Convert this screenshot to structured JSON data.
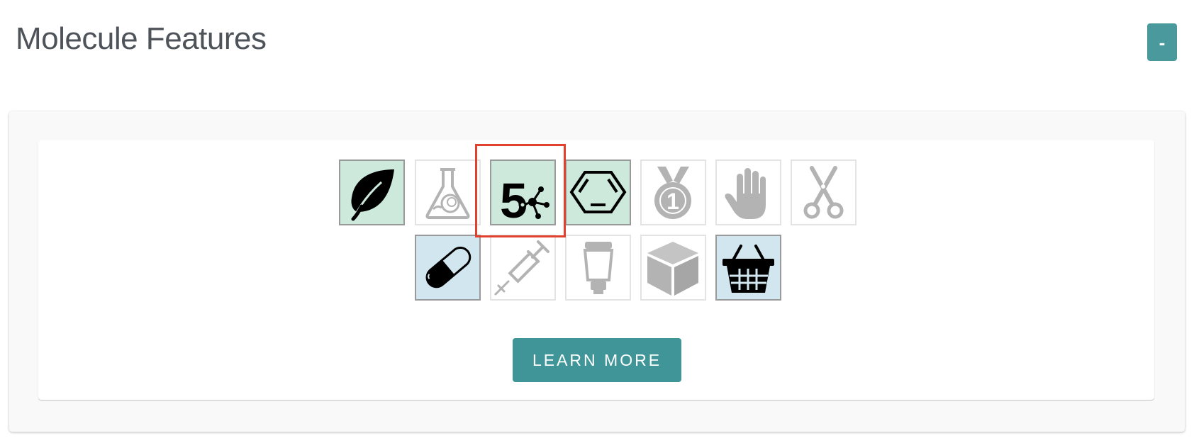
{
  "page": {
    "title": "Molecule Features",
    "collapse_label": "-"
  },
  "features": {
    "row1": [
      {
        "icon": "leaf-icon",
        "state": "active",
        "color": "#cce9dc"
      },
      {
        "icon": "flask-icon",
        "state": "inactive"
      },
      {
        "icon": "rule-of-five-icon",
        "state": "active",
        "color": "#cce9dc",
        "highlighted": true
      },
      {
        "icon": "benzene-ring-icon",
        "state": "active",
        "color": "#cce9dc"
      },
      {
        "icon": "medal-icon",
        "state": "inactive"
      },
      {
        "icon": "hand-icon",
        "state": "inactive"
      },
      {
        "icon": "scissors-icon",
        "state": "inactive"
      }
    ],
    "row2": [
      {
        "icon": "pill-capsule-icon",
        "state": "active",
        "color": "#d1e6ef"
      },
      {
        "icon": "syringe-icon",
        "state": "inactive"
      },
      {
        "icon": "cream-tube-icon",
        "state": "inactive"
      },
      {
        "icon": "cube-icon",
        "state": "inactive"
      },
      {
        "icon": "basket-icon",
        "state": "active",
        "color": "#d1e6ef"
      }
    ],
    "medal_number": "1",
    "rule_number": "5"
  },
  "actions": {
    "learn_more_label": "LEARN MORE"
  },
  "colors": {
    "accent": "#3f9597",
    "highlight": "#e0402c",
    "active_green": "#cce9dc",
    "active_blue": "#d1e6ef",
    "inactive_icon": "#b3b3b3"
  }
}
